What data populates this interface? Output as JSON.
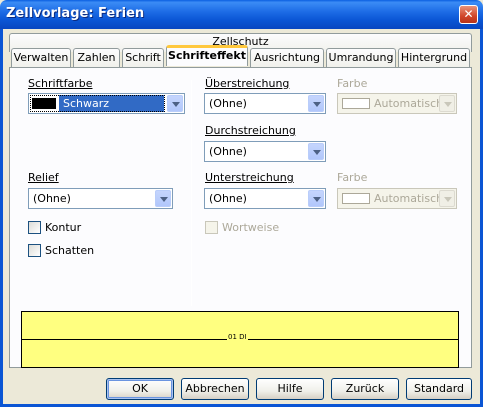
{
  "window": {
    "title": "Zellvorlage: Ferien"
  },
  "tabs": {
    "back_row": [
      "Zellschutz"
    ],
    "front_row": [
      "Verwalten",
      "Zahlen",
      "Schrift",
      "Schrifteffekt",
      "Ausrichtung",
      "Umrandung",
      "Hintergrund"
    ],
    "active": "Schrifteffekt"
  },
  "font_color": {
    "label": "Schriftfarbe",
    "value": "Schwarz",
    "swatch_color": "#000000"
  },
  "relief": {
    "label": "Relief",
    "value": "(Ohne)"
  },
  "outline": {
    "label": "Kontur",
    "checked": false
  },
  "shadow": {
    "label": "Schatten",
    "checked": false
  },
  "overline": {
    "label": "Überstreichung",
    "value": "(Ohne)"
  },
  "overline_color": {
    "label": "Farbe",
    "value": "Automatisch"
  },
  "strikethrough": {
    "label": "Durchstreichung",
    "value": "(Ohne)"
  },
  "underline": {
    "label": "Unterstreichung",
    "value": "(Ohne)"
  },
  "underline_color": {
    "label": "Farbe",
    "value": "Automatisch"
  },
  "word_wise": {
    "label": "Wortweise",
    "checked": false
  },
  "preview": {
    "text": "01 DI",
    "background": "#ffff80"
  },
  "buttons": {
    "ok": "OK",
    "cancel": "Abbrechen",
    "help": "Hilfe",
    "back": "Zurück",
    "standard": "Standard"
  }
}
